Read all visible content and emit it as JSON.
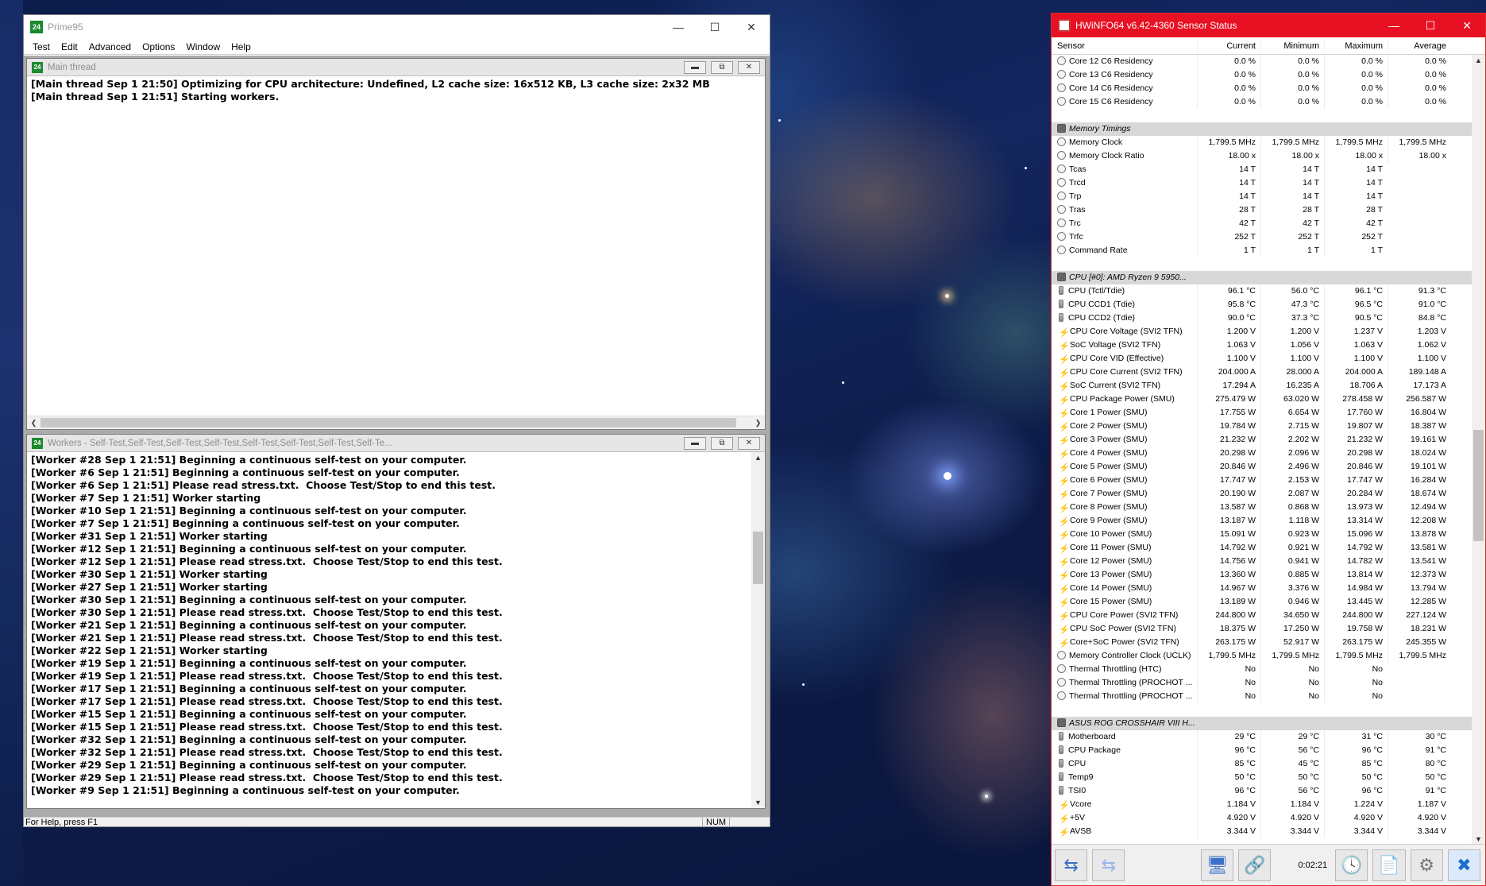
{
  "prime95": {
    "title": "Prime95",
    "menu": [
      "Test",
      "Edit",
      "Advanced",
      "Options",
      "Window",
      "Help"
    ],
    "main_thread": {
      "title": "Main thread",
      "lines": [
        "[Main thread Sep 1 21:50] Optimizing for CPU architecture: Undefined, L2 cache size: 16x512 KB, L3 cache size: 2x32 MB",
        "[Main thread Sep 1 21:51] Starting workers."
      ]
    },
    "workers": {
      "title": "Workers - Self-Test,Self-Test,Self-Test,Self-Test,Self-Test,Self-Test,Self-Test,Self-Te...",
      "lines": [
        "[Worker #28 Sep 1 21:51] Beginning a continuous self-test on your computer.",
        "[Worker #6 Sep 1 21:51] Beginning a continuous self-test on your computer.",
        "[Worker #6 Sep 1 21:51] Please read stress.txt.  Choose Test/Stop to end this test.",
        "[Worker #7 Sep 1 21:51] Worker starting",
        "[Worker #10 Sep 1 21:51] Beginning a continuous self-test on your computer.",
        "[Worker #7 Sep 1 21:51] Beginning a continuous self-test on your computer.",
        "[Worker #31 Sep 1 21:51] Worker starting",
        "[Worker #12 Sep 1 21:51] Beginning a continuous self-test on your computer.",
        "[Worker #12 Sep 1 21:51] Please read stress.txt.  Choose Test/Stop to end this test.",
        "[Worker #30 Sep 1 21:51] Worker starting",
        "[Worker #27 Sep 1 21:51] Worker starting",
        "[Worker #30 Sep 1 21:51] Beginning a continuous self-test on your computer.",
        "[Worker #30 Sep 1 21:51] Please read stress.txt.  Choose Test/Stop to end this test.",
        "[Worker #21 Sep 1 21:51] Beginning a continuous self-test on your computer.",
        "[Worker #21 Sep 1 21:51] Please read stress.txt.  Choose Test/Stop to end this test.",
        "[Worker #22 Sep 1 21:51] Worker starting",
        "[Worker #19 Sep 1 21:51] Beginning a continuous self-test on your computer.",
        "[Worker #19 Sep 1 21:51] Please read stress.txt.  Choose Test/Stop to end this test.",
        "[Worker #17 Sep 1 21:51] Beginning a continuous self-test on your computer.",
        "[Worker #17 Sep 1 21:51] Please read stress.txt.  Choose Test/Stop to end this test.",
        "[Worker #15 Sep 1 21:51] Beginning a continuous self-test on your computer.",
        "[Worker #15 Sep 1 21:51] Please read stress.txt.  Choose Test/Stop to end this test.",
        "[Worker #32 Sep 1 21:51] Beginning a continuous self-test on your computer.",
        "[Worker #32 Sep 1 21:51] Please read stress.txt.  Choose Test/Stop to end this test.",
        "[Worker #29 Sep 1 21:51] Beginning a continuous self-test on your computer.",
        "[Worker #29 Sep 1 21:51] Please read stress.txt.  Choose Test/Stop to end this test.",
        "[Worker #9 Sep 1 21:51] Beginning a continuous self-test on your computer."
      ]
    },
    "status": {
      "help": "For Help, press F1",
      "num": "NUM"
    }
  },
  "hwinfo": {
    "title": "HWiNFO64 v6.42-4360 Sensor Status",
    "columns": [
      "Sensor",
      "Current",
      "Minimum",
      "Maximum",
      "Average"
    ],
    "rows": [
      {
        "t": "c",
        "n": "Core 12 C6 Residency",
        "v": [
          "0.0 %",
          "0.0 %",
          "0.0 %",
          "0.0 %"
        ]
      },
      {
        "t": "c",
        "n": "Core 13 C6 Residency",
        "v": [
          "0.0 %",
          "0.0 %",
          "0.0 %",
          "0.0 %"
        ]
      },
      {
        "t": "c",
        "n": "Core 14 C6 Residency",
        "v": [
          "0.0 %",
          "0.0 %",
          "0.0 %",
          "0.0 %"
        ]
      },
      {
        "t": "c",
        "n": "Core 15 C6 Residency",
        "v": [
          "0.0 %",
          "0.0 %",
          "0.0 %",
          "0.0 %"
        ]
      },
      {
        "t": "blank"
      },
      {
        "t": "group",
        "n": "Memory Timings"
      },
      {
        "t": "c",
        "n": "Memory Clock",
        "v": [
          "1,799.5 MHz",
          "1,799.5 MHz",
          "1,799.5 MHz",
          "1,799.5 MHz"
        ]
      },
      {
        "t": "c",
        "n": "Memory Clock Ratio",
        "v": [
          "18.00 x",
          "18.00 x",
          "18.00 x",
          "18.00 x"
        ]
      },
      {
        "t": "c",
        "n": "Tcas",
        "v": [
          "14 T",
          "14 T",
          "14 T",
          ""
        ]
      },
      {
        "t": "c",
        "n": "Trcd",
        "v": [
          "14 T",
          "14 T",
          "14 T",
          ""
        ]
      },
      {
        "t": "c",
        "n": "Trp",
        "v": [
          "14 T",
          "14 T",
          "14 T",
          ""
        ]
      },
      {
        "t": "c",
        "n": "Tras",
        "v": [
          "28 T",
          "28 T",
          "28 T",
          ""
        ]
      },
      {
        "t": "c",
        "n": "Trc",
        "v": [
          "42 T",
          "42 T",
          "42 T",
          ""
        ]
      },
      {
        "t": "c",
        "n": "Trfc",
        "v": [
          "252 T",
          "252 T",
          "252 T",
          ""
        ]
      },
      {
        "t": "c",
        "n": "Command Rate",
        "v": [
          "1 T",
          "1 T",
          "1 T",
          ""
        ]
      },
      {
        "t": "blank"
      },
      {
        "t": "group",
        "n": "CPU [#0]: AMD Ryzen 9 5950..."
      },
      {
        "t": "t",
        "n": "CPU (Tctl/Tdie)",
        "v": [
          "96.1 °C",
          "56.0 °C",
          "96.1 °C",
          "91.3 °C"
        ]
      },
      {
        "t": "t",
        "n": "CPU CCD1 (Tdie)",
        "v": [
          "95.8 °C",
          "47.3 °C",
          "96.5 °C",
          "91.0 °C"
        ]
      },
      {
        "t": "t",
        "n": "CPU CCD2 (Tdie)",
        "v": [
          "90.0 °C",
          "37.3 °C",
          "90.5 °C",
          "84.8 °C"
        ]
      },
      {
        "t": "v",
        "n": "CPU Core Voltage (SVI2 TFN)",
        "v": [
          "1.200 V",
          "1.200 V",
          "1.237 V",
          "1.203 V"
        ]
      },
      {
        "t": "v",
        "n": "SoC Voltage (SVI2 TFN)",
        "v": [
          "1.063 V",
          "1.056 V",
          "1.063 V",
          "1.062 V"
        ]
      },
      {
        "t": "v",
        "n": "CPU Core VID (Effective)",
        "v": [
          "1.100 V",
          "1.100 V",
          "1.100 V",
          "1.100 V"
        ]
      },
      {
        "t": "v",
        "n": "CPU Core Current (SVI2 TFN)",
        "v": [
          "204.000 A",
          "28.000 A",
          "204.000 A",
          "189.148 A"
        ]
      },
      {
        "t": "v",
        "n": "SoC Current (SVI2 TFN)",
        "v": [
          "17.294 A",
          "16.235 A",
          "18.706 A",
          "17.173 A"
        ]
      },
      {
        "t": "v",
        "n": "CPU Package Power (SMU)",
        "v": [
          "275.479 W",
          "63.020 W",
          "278.458 W",
          "256.587 W"
        ]
      },
      {
        "t": "v",
        "n": "Core 1 Power (SMU)",
        "v": [
          "17.755 W",
          "6.654 W",
          "17.760 W",
          "16.804 W"
        ]
      },
      {
        "t": "v",
        "n": "Core 2 Power (SMU)",
        "v": [
          "19.784 W",
          "2.715 W",
          "19.807 W",
          "18.387 W"
        ]
      },
      {
        "t": "v",
        "n": "Core 3 Power (SMU)",
        "v": [
          "21.232 W",
          "2.202 W",
          "21.232 W",
          "19.161 W"
        ]
      },
      {
        "t": "v",
        "n": "Core 4 Power (SMU)",
        "v": [
          "20.298 W",
          "2.096 W",
          "20.298 W",
          "18.024 W"
        ]
      },
      {
        "t": "v",
        "n": "Core 5 Power (SMU)",
        "v": [
          "20.846 W",
          "2.496 W",
          "20.846 W",
          "19.101 W"
        ]
      },
      {
        "t": "v",
        "n": "Core 6 Power (SMU)",
        "v": [
          "17.747 W",
          "2.153 W",
          "17.747 W",
          "16.284 W"
        ]
      },
      {
        "t": "v",
        "n": "Core 7 Power (SMU)",
        "v": [
          "20.190 W",
          "2.087 W",
          "20.284 W",
          "18.674 W"
        ]
      },
      {
        "t": "v",
        "n": "Core 8 Power (SMU)",
        "v": [
          "13.587 W",
          "0.868 W",
          "13.973 W",
          "12.494 W"
        ]
      },
      {
        "t": "v",
        "n": "Core 9 Power (SMU)",
        "v": [
          "13.187 W",
          "1.118 W",
          "13.314 W",
          "12.208 W"
        ]
      },
      {
        "t": "v",
        "n": "Core 10 Power (SMU)",
        "v": [
          "15.091 W",
          "0.923 W",
          "15.096 W",
          "13.878 W"
        ]
      },
      {
        "t": "v",
        "n": "Core 11 Power (SMU)",
        "v": [
          "14.792 W",
          "0.921 W",
          "14.792 W",
          "13.581 W"
        ]
      },
      {
        "t": "v",
        "n": "Core 12 Power (SMU)",
        "v": [
          "14.756 W",
          "0.941 W",
          "14.782 W",
          "13.541 W"
        ]
      },
      {
        "t": "v",
        "n": "Core 13 Power (SMU)",
        "v": [
          "13.360 W",
          "0.885 W",
          "13.814 W",
          "12.373 W"
        ]
      },
      {
        "t": "v",
        "n": "Core 14 Power (SMU)",
        "v": [
          "14.967 W",
          "3.376 W",
          "14.984 W",
          "13.794 W"
        ]
      },
      {
        "t": "v",
        "n": "Core 15 Power (SMU)",
        "v": [
          "13.189 W",
          "0.946 W",
          "13.445 W",
          "12.285 W"
        ]
      },
      {
        "t": "v",
        "n": "CPU Core Power (SVI2 TFN)",
        "v": [
          "244.800 W",
          "34.650 W",
          "244.800 W",
          "227.124 W"
        ]
      },
      {
        "t": "v",
        "n": "CPU SoC Power (SVI2 TFN)",
        "v": [
          "18.375 W",
          "17.250 W",
          "19.758 W",
          "18.231 W"
        ]
      },
      {
        "t": "v",
        "n": "Core+SoC Power (SVI2 TFN)",
        "v": [
          "263.175 W",
          "52.917 W",
          "263.175 W",
          "245.355 W"
        ]
      },
      {
        "t": "c",
        "n": "Memory Controller Clock (UCLK)",
        "v": [
          "1,799.5 MHz",
          "1,799.5 MHz",
          "1,799.5 MHz",
          "1,799.5 MHz"
        ]
      },
      {
        "t": "c",
        "n": "Thermal Throttling (HTC)",
        "v": [
          "No",
          "No",
          "No",
          ""
        ]
      },
      {
        "t": "c",
        "n": "Thermal Throttling (PROCHOT ...",
        "v": [
          "No",
          "No",
          "No",
          ""
        ]
      },
      {
        "t": "c",
        "n": "Thermal Throttling (PROCHOT ...",
        "v": [
          "No",
          "No",
          "No",
          ""
        ]
      },
      {
        "t": "blank"
      },
      {
        "t": "group",
        "n": "ASUS ROG CROSSHAIR VIII H..."
      },
      {
        "t": "t",
        "n": "Motherboard",
        "v": [
          "29 °C",
          "29 °C",
          "31 °C",
          "30 °C"
        ]
      },
      {
        "t": "t",
        "n": "CPU Package",
        "v": [
          "96 °C",
          "56 °C",
          "96 °C",
          "91 °C"
        ]
      },
      {
        "t": "t",
        "n": "CPU",
        "v": [
          "85 °C",
          "45 °C",
          "85 °C",
          "80 °C"
        ]
      },
      {
        "t": "t",
        "n": "Temp9",
        "v": [
          "50 °C",
          "50 °C",
          "50 °C",
          "50 °C"
        ]
      },
      {
        "t": "t",
        "n": "TSI0",
        "v": [
          "96 °C",
          "56 °C",
          "96 °C",
          "91 °C"
        ]
      },
      {
        "t": "v",
        "n": "Vcore",
        "v": [
          "1.184 V",
          "1.184 V",
          "1.224 V",
          "1.187 V"
        ]
      },
      {
        "t": "v",
        "n": "+5V",
        "v": [
          "4.920 V",
          "4.920 V",
          "4.920 V",
          "4.920 V"
        ]
      },
      {
        "t": "v",
        "n": "AVSB",
        "v": [
          "3.344 V",
          "3.344 V",
          "3.344 V",
          "3.344 V"
        ]
      }
    ],
    "timer": "0:02:21"
  }
}
